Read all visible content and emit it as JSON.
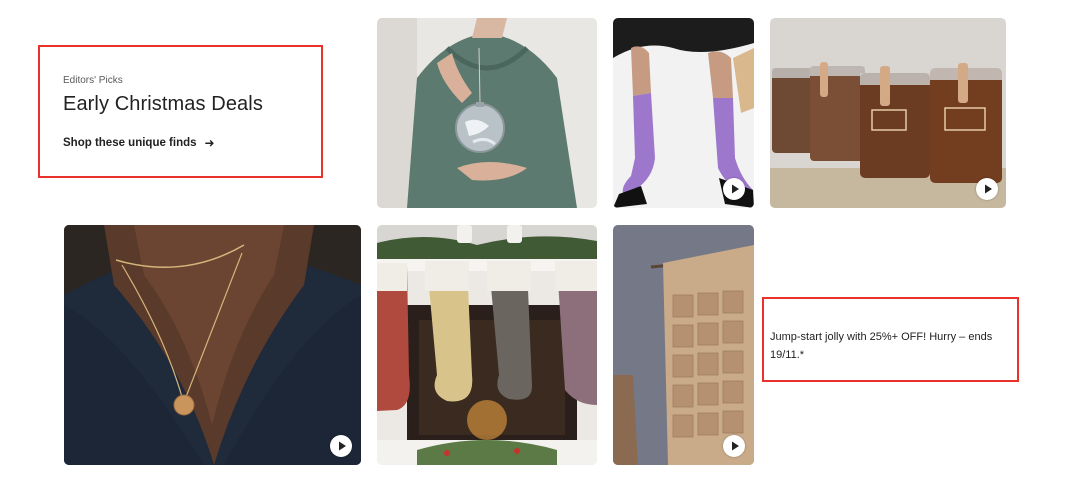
{
  "editors_picks": {
    "kicker": "Editors' Picks",
    "title": "Early Christmas Deals",
    "link_label": "Shop these unique finds",
    "link_icon": "arrow-right-icon"
  },
  "promo": {
    "text": "Jump-start jolly with 25%+ OFF! Hurry – ends 19/11.*"
  },
  "tiles": [
    {
      "subject": "ornament-sweater",
      "has_video": false
    },
    {
      "subject": "sheer-socks",
      "has_video": true
    },
    {
      "subject": "engraved-whiskey-glasses",
      "has_video": true
    },
    {
      "subject": "gold-necklace",
      "has_video": true
    },
    {
      "subject": "christmas-stockings",
      "has_video": false
    },
    {
      "subject": "advent-calendar",
      "has_video": true
    }
  ],
  "colors": {
    "highlight": "#e8322b",
    "text": "#222222",
    "muted_text": "#595959"
  }
}
